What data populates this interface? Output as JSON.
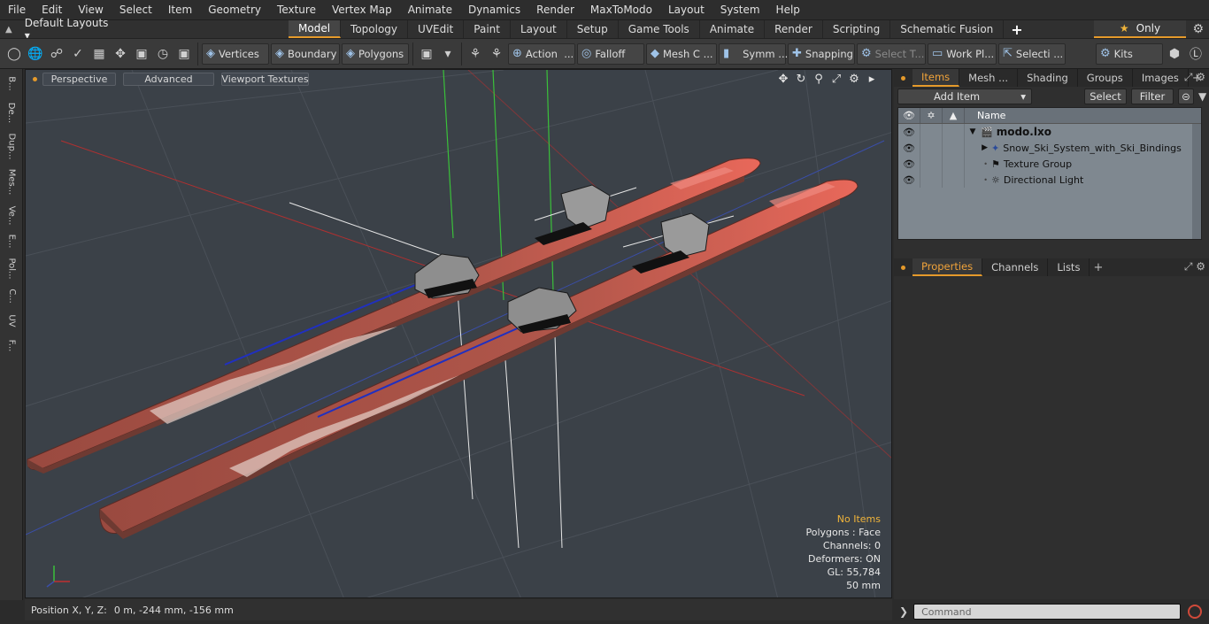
{
  "menu": [
    "File",
    "Edit",
    "View",
    "Select",
    "Item",
    "Geometry",
    "Texture",
    "Vertex Map",
    "Animate",
    "Dynamics",
    "Render",
    "MaxToModo",
    "Layout",
    "System",
    "Help"
  ],
  "layout": {
    "label": "Default Layouts ▾"
  },
  "tabs": [
    "Model",
    "Topology",
    "UVEdit",
    "Paint",
    "Layout",
    "Setup",
    "Game Tools",
    "Animate",
    "Render",
    "Scripting",
    "Schematic Fusion"
  ],
  "active_tab": "Model",
  "only_label": "Only",
  "toolbar": {
    "vertices": "Vertices",
    "boundary": "Boundary",
    "polygons": "Polygons",
    "action": "Action",
    "falloff": "Falloff",
    "mesh": "Mesh C ...",
    "symm": "Symm ...",
    "snapping": "Snapping",
    "select_t": "Select T...",
    "work_pl": "Work Pl...",
    "selecti": "Selecti ...",
    "kits": "Kits"
  },
  "left_tabs": [
    "B...",
    "De...",
    "Dup...",
    "Mes...",
    "Ve...",
    "E...",
    "Pol...",
    "C...",
    "UV",
    "F..."
  ],
  "viewport": {
    "perspective": "Perspective",
    "advanced": "Advanced",
    "textures": "Viewport Textures",
    "info": {
      "no_items": "No Items",
      "polygons": "Polygons : Face",
      "channels": "Channels: 0",
      "deformers": "Deformers: ON",
      "gl": "GL: 55,784",
      "scale": "50 mm"
    }
  },
  "status": {
    "label": "Position X, Y, Z:",
    "value": "0 m, -244 mm, -156 mm"
  },
  "items_panel": {
    "tabs": [
      "Items",
      "Mesh ...",
      "Shading",
      "Groups",
      "Images"
    ],
    "add_item": "Add Item",
    "select": "Select",
    "filter": "Filter",
    "column_name": "Name",
    "rows": [
      {
        "label": "modo.lxo"
      },
      {
        "label": "Snow_Ski_System_with_Ski_Bindings"
      },
      {
        "label": "Texture Group"
      },
      {
        "label": "Directional Light"
      }
    ]
  },
  "props_panel": {
    "tabs": [
      "Properties",
      "Channels",
      "Lists"
    ]
  },
  "command": {
    "placeholder": "Command"
  }
}
